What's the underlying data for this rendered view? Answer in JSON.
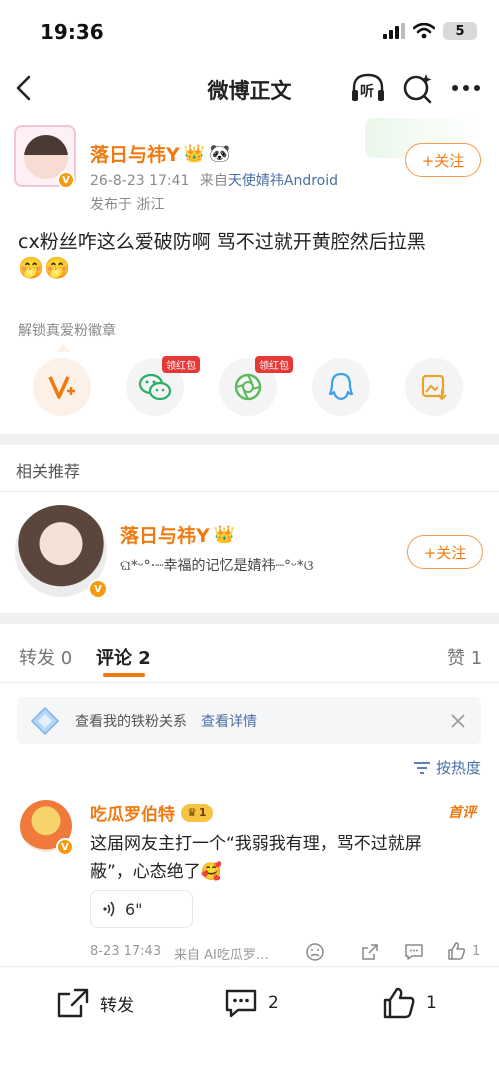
{
  "status_bar": {
    "time": "19:36",
    "battery": "5"
  },
  "nav": {
    "title": "微博正文",
    "listen_label": "听"
  },
  "post": {
    "author_name": "落日与祎Y",
    "timestamp": "26-8-23 17:41",
    "source_prefix": "来自",
    "source_app": "天使婧祎Android",
    "location": "发布于 浙江",
    "follow_label": "+关注",
    "text": "cx粉丝咋这么爱破防啊 骂不过就开黄腔然后拉黑",
    "emojis": "🤭🤭",
    "unlock_fan_badge": "解锁真爱粉徽章",
    "red_packet_tag": "领红包"
  },
  "recommend": {
    "section_title": "相关推荐",
    "name": "落日与祎Y",
    "bio": "ଘ*ᵕ°·┈幸福的记忆是婧祎┈°ᵕ*ଓ",
    "follow_label": "+关注"
  },
  "tabs": {
    "repost": "转发 0",
    "comment": "评论 2",
    "like": "赞 1"
  },
  "fan_banner": {
    "text": "查看我的铁粉关系",
    "link": "查看详情"
  },
  "sort": {
    "label": "按热度"
  },
  "comment": {
    "author": "吃瓜罗伯特",
    "level": "1",
    "first_badge": "首评",
    "text_line1": "这届网友主打一个“我弱我有理，骂不过就屏",
    "text_line2": "蔽”，心态绝了🥰",
    "voice_duration": "6\"",
    "time": "8-23 17:43",
    "source": "来自 AI吃瓜罗…",
    "like_count": "1"
  },
  "bottom_bar": {
    "repost": "转发",
    "comment_count": "2",
    "like_count": "1"
  },
  "colors": {
    "accent_orange": "#f07a12",
    "link_blue": "#4a6fa5",
    "red_tag": "#e53935"
  }
}
